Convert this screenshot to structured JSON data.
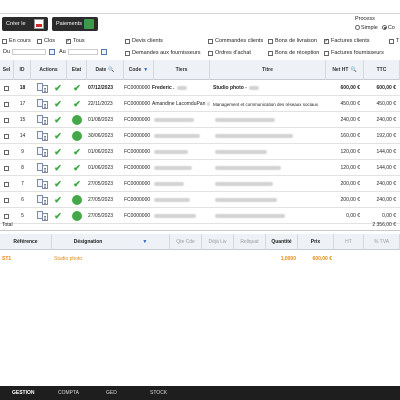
{
  "toolbar": {
    "create_label": "Créer le",
    "payments_label": "Paiements"
  },
  "process": {
    "title": "Process",
    "simple_label": "Simple",
    "complex_label": "Co"
  },
  "filters": {
    "en_cours": "En cours",
    "clos": "Clos",
    "tous": "Tous",
    "du": "Du",
    "au": "Au",
    "devis_clients": "Devis clients",
    "commandes_clients": "Commandes clients",
    "bons_livraison": "Bons de livraison",
    "factures_clients": "Factures clients",
    "demandes_fournisseurs": "Demandes aux fournisseurs",
    "ordres_achat": "Ordres d'achat",
    "bons_reception": "Bons de réception",
    "factures_fournisseurs": "Factures fournisseurs",
    "truncated": "T"
  },
  "grid": {
    "headers": {
      "sel": "Sel",
      "id": "ID",
      "actions": "Actions",
      "etat": "Etat",
      "date": "Date",
      "code": "Code",
      "tiers": "Tiers",
      "titre": "Titre",
      "net_ht": "Net HT",
      "ttc": "TTC"
    },
    "rows": [
      {
        "id": "18",
        "etat": "check",
        "date": "07/12/2023",
        "code": "FC0000000",
        "tiers": "Frederic .",
        "titre": "Studio photo -",
        "net": "600,00 €",
        "ttc": "600,00 €",
        "bold": true
      },
      {
        "id": "17",
        "etat": "check",
        "date": "22/11/2023",
        "code": "FC0000000",
        "tiers": "Amandine LacomduPan",
        "titre": "Management et communication des réseaux sociaux",
        "net": "450,00 €",
        "ttc": "450,00 €",
        "bold": false
      },
      {
        "id": "15",
        "etat": "dot",
        "date": "01/08/2023",
        "code": "FC0000000",
        "tiers": "",
        "titre": "",
        "net": "240,00 €",
        "ttc": "240,00 €",
        "bold": false
      },
      {
        "id": "14",
        "etat": "dot",
        "date": "30/06/2023",
        "code": "FC0000000",
        "tiers": "",
        "titre": "",
        "net": "160,00 €",
        "ttc": "192,00 €",
        "bold": false
      },
      {
        "id": "9",
        "etat": "check",
        "date": "01/06/2023",
        "code": "FC0000000",
        "tiers": "",
        "titre": "",
        "net": "120,00 €",
        "ttc": "144,00 €",
        "bold": false
      },
      {
        "id": "8",
        "etat": "check",
        "date": "01/06/2023",
        "code": "FC0000000",
        "tiers": "",
        "titre": "",
        "net": "120,00 €",
        "ttc": "144,00 €",
        "bold": false
      },
      {
        "id": "7",
        "etat": "check",
        "date": "27/05/2023",
        "code": "FC0000000",
        "tiers": "",
        "titre": "",
        "net": "200,00 €",
        "ttc": "240,00 €",
        "bold": false
      },
      {
        "id": "6",
        "etat": "dot",
        "date": "27/05/2023",
        "code": "FC0000000",
        "tiers": "",
        "titre": "",
        "net": "200,00 €",
        "ttc": "240,00 €",
        "bold": false
      },
      {
        "id": "5",
        "etat": "dot",
        "date": "27/05/2023",
        "code": "FC0000000",
        "tiers": "",
        "titre": "",
        "net": "0,00 €",
        "ttc": "0,00 €",
        "bold": false
      }
    ],
    "total_label": "Total",
    "total_value": "2 356,00 €"
  },
  "detail": {
    "headers": {
      "reference": "Référence",
      "designation": "Désignation",
      "qte_cde": "Qte Cde",
      "deja_liv": "Déjà Liv",
      "reliquat": "Reliquat",
      "quantite": "Quantité",
      "prix": "Prix",
      "ht": "HT",
      "tva": "% TVA"
    },
    "line": {
      "reference": "ST1",
      "designation": "Studio photo",
      "quantite": "1,0000",
      "prix": "600,00 €"
    }
  },
  "footer": {
    "tabs": [
      "GESTION",
      "COMPTA",
      "GED",
      "STOCK"
    ]
  },
  "colors": {
    "accent_orange": "#e38b12",
    "status_green": "#43a84a",
    "dark": "#2b2b2b"
  }
}
